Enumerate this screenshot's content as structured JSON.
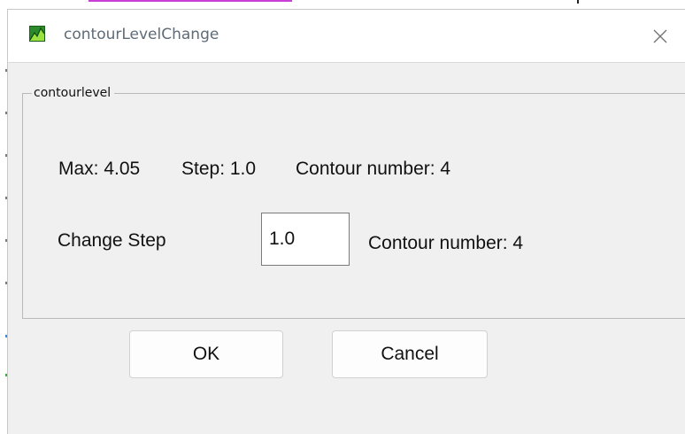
{
  "window": {
    "title": "contourLevelChange",
    "app_icon": "contour-app-icon",
    "close_icon": "close-icon"
  },
  "group": {
    "legend": "contourlevel"
  },
  "info": {
    "max_text": "Max: 4.05",
    "step_text": "Step: 1.0",
    "contour_text": "Contour number: 4"
  },
  "change_row": {
    "label": "Change Step",
    "step_value": "1.0",
    "contour_text": "Contour number: 4"
  },
  "buttons": {
    "ok": "OK",
    "cancel": "Cancel"
  },
  "colors": {
    "dialog_bg": "#f0f0f0",
    "titlebar_bg": "#ffffff",
    "title_text": "#5f6b77",
    "accent": "#c93fd6"
  }
}
